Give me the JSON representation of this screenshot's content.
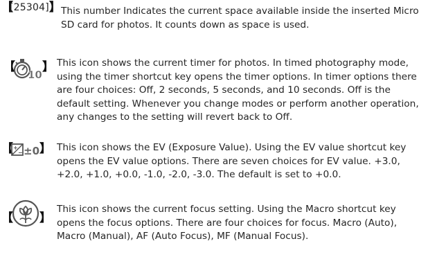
{
  "entries": [
    {
      "marker_text": "[25304]",
      "icon": null,
      "description": "This number Indicates the current space available inside the inserted Micro SD card for photos. It counts down as space is used."
    },
    {
      "marker_text": null,
      "icon": "self-timer-10-icon",
      "description": "This icon shows the current timer for photos. In timed photography mode, using the timer shortcut key opens the timer options. In timer options there are four choices: Off, 2 seconds, 5 seconds, and 10 seconds. Off is the default setting. Whenever you change modes or perform another operation, any changes to the setting will revert back to Off."
    },
    {
      "marker_text": null,
      "icon": "exposure-value-icon",
      "description": "This icon shows the EV (Exposure Value). Using the EV value shortcut key opens the EV value options. There are seven choices for EV value. +3.0, +2.0, +1.0, +0.0, -1.0, -2.0, -3.0. The default is set to +0.0."
    },
    {
      "marker_text": null,
      "icon": "macro-flower-icon",
      "description": "This icon shows the current focus setting. Using the Macro shortcut key opens the focus options. There are four choices for focus. Macro (Auto), Macro (Manual), AF (Auto Focus), MF (Manual Focus)."
    }
  ],
  "brackets": {
    "open": "【",
    "close": "】"
  }
}
